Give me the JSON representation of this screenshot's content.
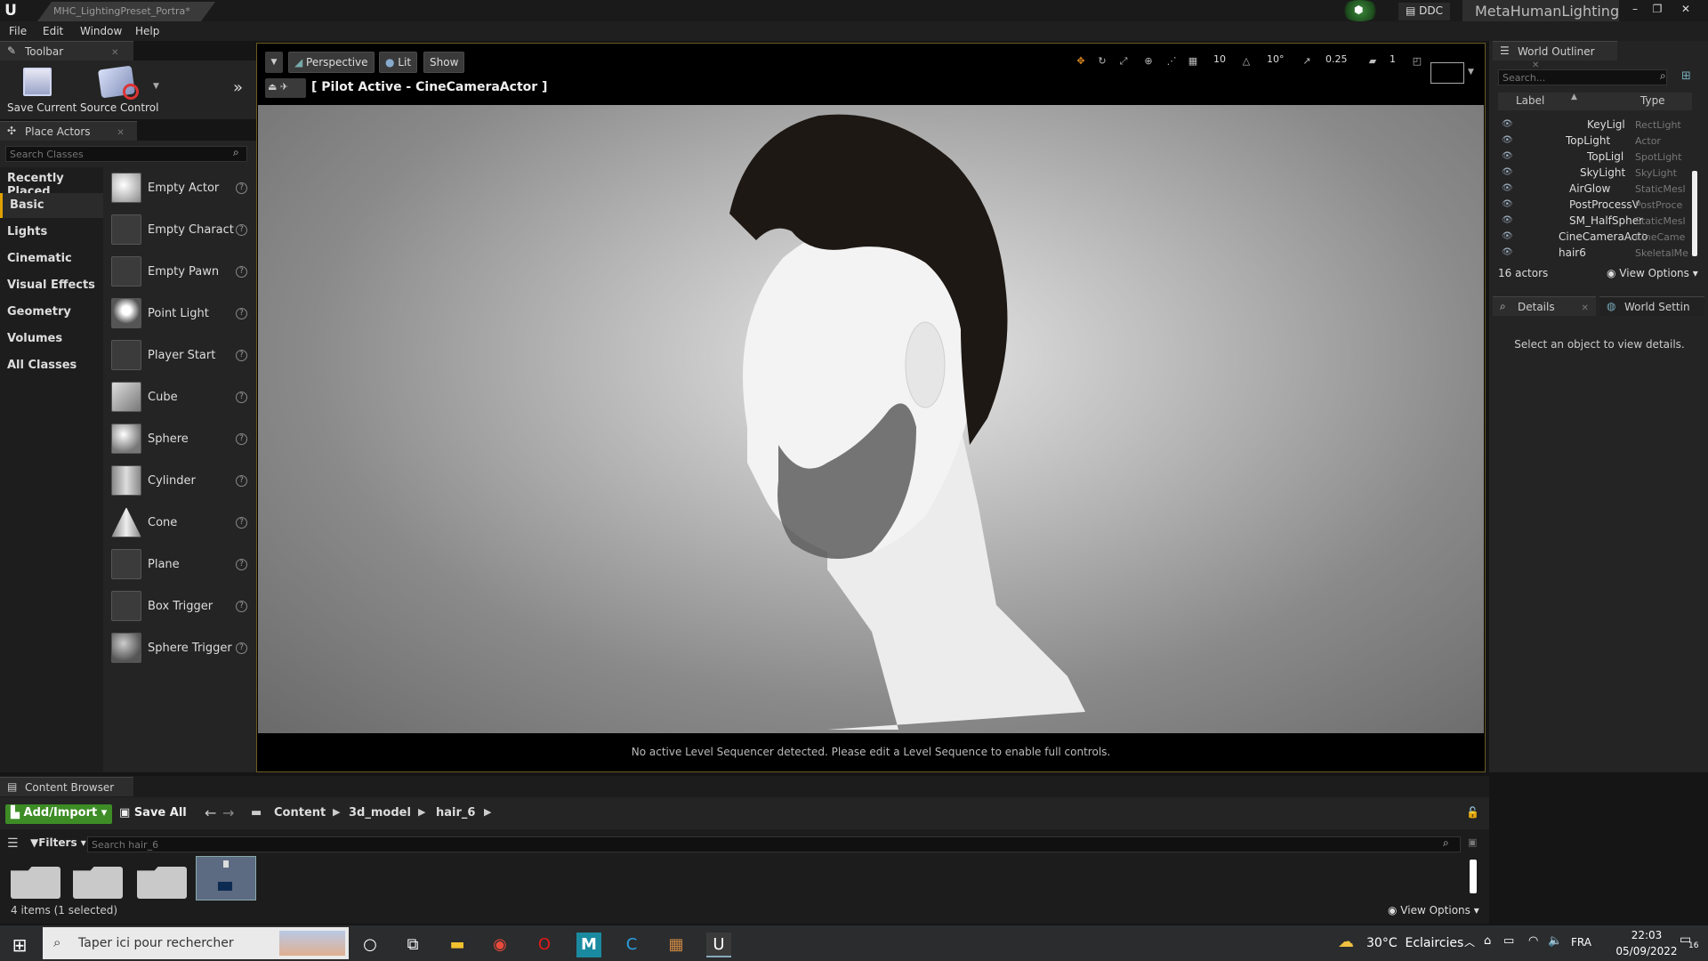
{
  "titlebar": {
    "doc_tab": "MHC_LightingPreset_Portra*",
    "ddc": "DDC",
    "project": "MetaHumanLighting"
  },
  "menu": [
    "File",
    "Edit",
    "Window",
    "Help"
  ],
  "toolbar": {
    "tab": "Toolbar",
    "save_label": "Save Current",
    "source_label": "Source Control"
  },
  "place_actors": {
    "tab": "Place Actors",
    "search_placeholder": "Search Classes",
    "categories": [
      "Recently Placed",
      "Basic",
      "Lights",
      "Cinematic",
      "Visual Effects",
      "Geometry",
      "Volumes",
      "All Classes"
    ],
    "items": [
      "Empty Actor",
      "Empty Charact",
      "Empty Pawn",
      "Point Light",
      "Player Start",
      "Cube",
      "Sphere",
      "Cylinder",
      "Cone",
      "Plane",
      "Box Trigger",
      "Sphere Trigger"
    ]
  },
  "viewport": {
    "perspective": "Perspective",
    "lit": "Lit",
    "show": "Show",
    "pilot": "[ Pilot Active - CineCameraActor ]",
    "grid": "10",
    "angle": "10°",
    "scale": "0.25",
    "cam_speed": "1",
    "message": "No active Level Sequencer detected. Please edit a Level Sequence to enable full controls."
  },
  "outliner": {
    "tab": "World Outliner",
    "search_placeholder": "Search...",
    "col_label": "Label",
    "col_type": "Type",
    "rows": [
      {
        "label": "KeyLigl",
        "type": "RectLight"
      },
      {
        "label": "TopLight",
        "type": "Actor"
      },
      {
        "label": "TopLigl",
        "type": "SpotLight"
      },
      {
        "label": "SkyLight",
        "type": "SkyLight"
      },
      {
        "label": "AirGlow",
        "type": "StaticMesl"
      },
      {
        "label": "PostProcessV",
        "type": "PostProce"
      },
      {
        "label": "SM_HalfSpher",
        "type": "StaticMesl"
      },
      {
        "label": "CineCameraActo",
        "type": "CineCame"
      },
      {
        "label": "hair6",
        "type": "SkeletalMe"
      }
    ],
    "count": "16 actors",
    "view_options": "View Options"
  },
  "details": {
    "tab_details": "Details",
    "tab_world": "World Settin",
    "empty": "Select an object to view details."
  },
  "content_browser": {
    "tab": "Content Browser",
    "add_import": "Add/Import",
    "save_all": "Save All",
    "path": [
      "Content",
      "3d_model",
      "hair_6"
    ],
    "filters": "Filters",
    "search_placeholder": "Search hair_6",
    "status": "4 items (1 selected)",
    "view_options": "View Options"
  },
  "taskbar": {
    "search_placeholder": "Taper ici pour rechercher",
    "weather": "30°C  Eclaircies",
    "lang": "FRA",
    "time": "22:03",
    "date": "05/09/2022",
    "notif": "16"
  }
}
